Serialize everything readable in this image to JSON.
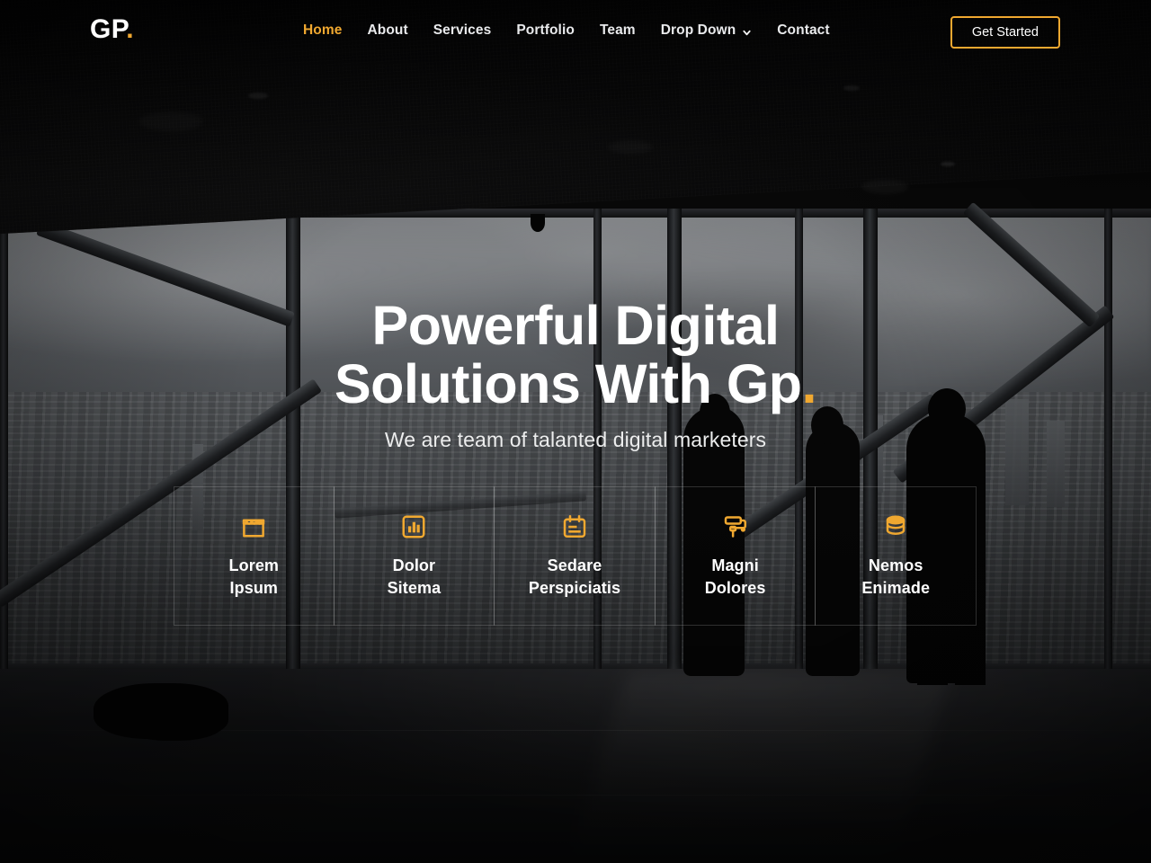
{
  "brand": {
    "name": "GP",
    "dot": ".",
    "accent_color": "#f0a830"
  },
  "nav": {
    "items": [
      {
        "label": "Home",
        "active": true,
        "icon": ""
      },
      {
        "label": "About",
        "active": false,
        "icon": ""
      },
      {
        "label": "Services",
        "active": false,
        "icon": ""
      },
      {
        "label": "Portfolio",
        "active": false,
        "icon": ""
      },
      {
        "label": "Team",
        "active": false,
        "icon": ""
      },
      {
        "label": "Drop Down",
        "active": false,
        "icon": "chevron-down-icon"
      },
      {
        "label": "Contact",
        "active": false,
        "icon": ""
      }
    ],
    "cta_label": "Get Started"
  },
  "hero": {
    "title_line1": "Powerful Digital",
    "title_line2": "Solutions With Gp",
    "title_dot": ".",
    "subtitle": "We are team of talanted digital marketers"
  },
  "feature_boxes": [
    {
      "icon": "store-icon",
      "title_line1": "Lorem",
      "title_line2": "Ipsum"
    },
    {
      "icon": "bar-chart-icon",
      "title_line1": "Dolor",
      "title_line2": "Sitema"
    },
    {
      "icon": "calendar-icon",
      "title_line1": "Sedare",
      "title_line2": "Perspiciatis"
    },
    {
      "icon": "paint-roller-icon",
      "title_line1": "Magni",
      "title_line2": "Dolores"
    },
    {
      "icon": "database-icon",
      "title_line1": "Nemos",
      "title_line2": "Enimade"
    }
  ]
}
